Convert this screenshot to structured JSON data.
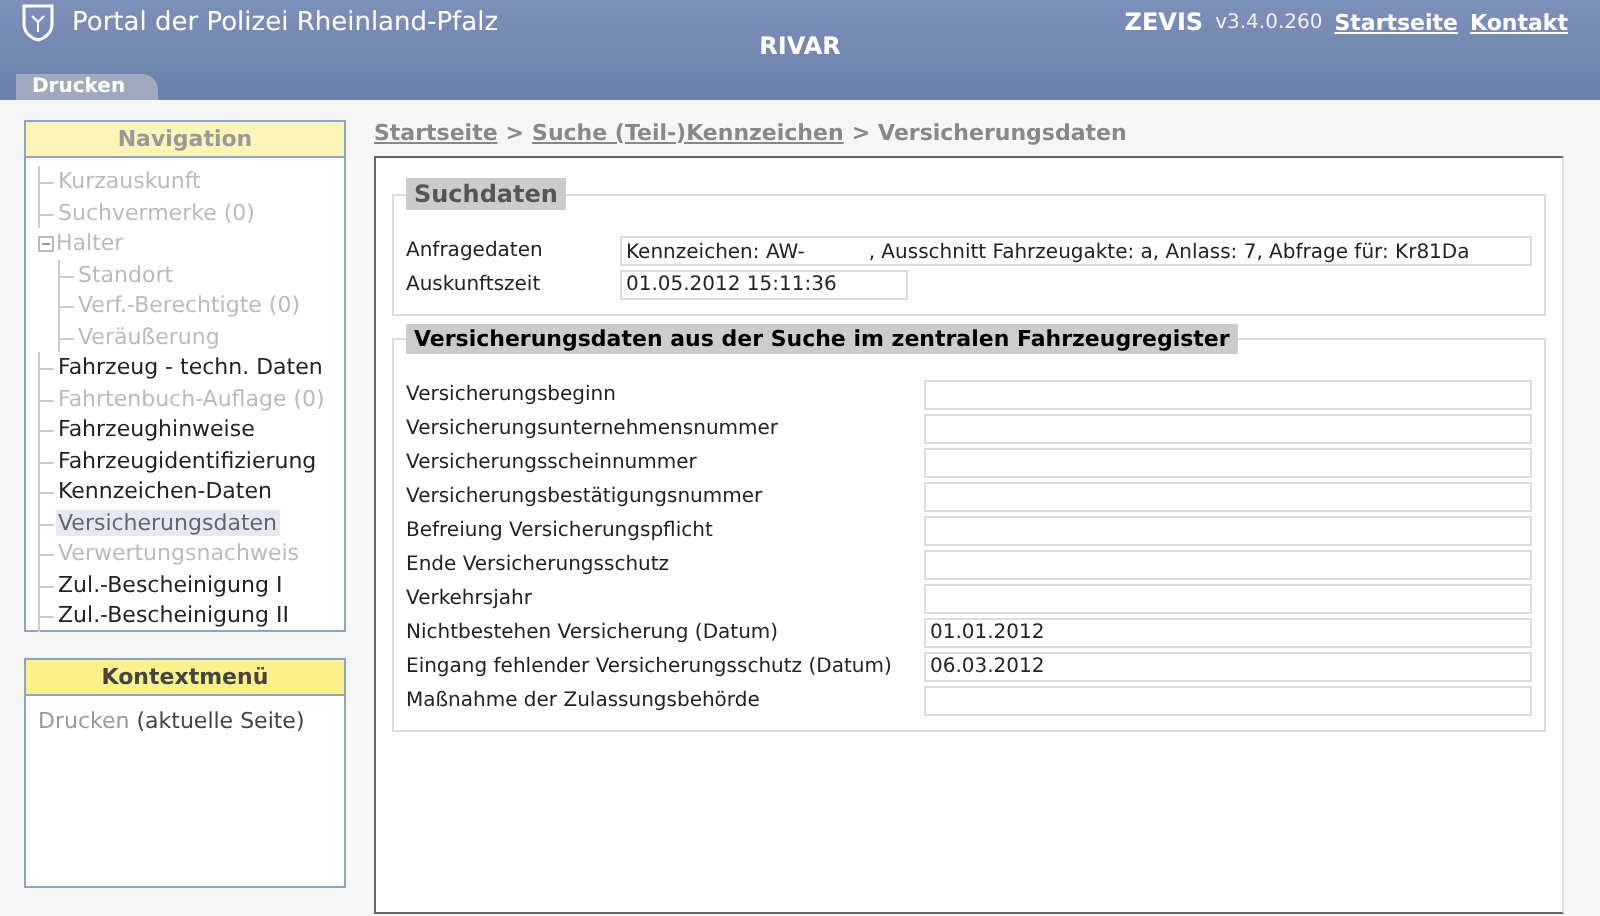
{
  "header": {
    "portal_title": "Portal der Polizei Rheinland-Pfalz",
    "app_title": "RIVAR",
    "product": "ZEVIS",
    "version": "v3.4.0.260",
    "links": [
      "Startseite",
      "Kontakt"
    ]
  },
  "tabs": [
    {
      "label": "Drucken",
      "selected": true
    }
  ],
  "navigation": {
    "title": "Navigation",
    "items": [
      {
        "label": "Kurzauskunft",
        "disabled": true,
        "selected": false
      },
      {
        "label": "Suchvermerke (0)",
        "disabled": true,
        "selected": false
      },
      {
        "label": "Halter",
        "disabled": true,
        "selected": false,
        "expanded": true,
        "children": [
          {
            "label": "Standort",
            "disabled": true,
            "selected": false
          },
          {
            "label": "Verf.-Berechtigte (0)",
            "disabled": true,
            "selected": false
          },
          {
            "label": "Veräußerung",
            "disabled": true,
            "selected": false
          }
        ]
      },
      {
        "label": "Fahrzeug - techn. Daten",
        "disabled": false,
        "selected": false
      },
      {
        "label": "Fahrtenbuch-Auflage (0)",
        "disabled": true,
        "selected": false
      },
      {
        "label": "Fahrzeughinweise",
        "disabled": false,
        "selected": false
      },
      {
        "label": "Fahrzeugidentifizierung",
        "disabled": false,
        "selected": false
      },
      {
        "label": "Kennzeichen-Daten",
        "disabled": false,
        "selected": false
      },
      {
        "label": "Versicherungsdaten",
        "disabled": false,
        "selected": true
      },
      {
        "label": "Verwertungsnachweis",
        "disabled": true,
        "selected": false
      },
      {
        "label": "Zul.-Bescheinigung I",
        "disabled": false,
        "selected": false
      },
      {
        "label": "Zul.-Bescheinigung II",
        "disabled": false,
        "selected": false
      }
    ]
  },
  "context_menu": {
    "title": "Kontextmenü",
    "items": [
      {
        "link": "Drucken",
        "note": "(aktuelle Seite)"
      }
    ]
  },
  "breadcrumb": [
    {
      "label": "Startseite",
      "link": true
    },
    {
      "label": "Suche (Teil-)Kennzeichen",
      "link": true
    },
    {
      "label": "Versicherungsdaten",
      "link": false
    }
  ],
  "separator": ">",
  "sections": [
    {
      "legend": "Suchdaten",
      "wide": true,
      "fields": [
        {
          "label": "Anfragedaten",
          "value_parts": [
            "Kennzeichen: AW-",
            ", Ausschnitt Fahrzeugakte: a, Anlass: 7, Abfrage für: Kr81Da"
          ],
          "redacted": true
        },
        {
          "label": "Auskunftszeit",
          "value": "01.05.2012 15:11:36"
        }
      ]
    },
    {
      "legend": "Versicherungsdaten aus der Suche im zentralen Fahrzeugregister",
      "wide": false,
      "fields": [
        {
          "label": "Versicherungsbeginn"
        },
        {
          "label": "Versicherungsunternehmensnummer"
        },
        {
          "label": "Versicherungsscheinnummer"
        },
        {
          "label": "Versicherungsbestätigungsnummer"
        },
        {
          "label": "Befreiung Versicherungspflicht"
        },
        {
          "label": "Ende Versicherungsschutz"
        },
        {
          "label": "Verkehrsjahr"
        },
        {
          "label": "Nichtbestehen Versicherung (Datum)",
          "value": "01.01.2012"
        },
        {
          "label": "Eingang fehlender Versicherungsschutz (Datum)",
          "value": "06.03.2012"
        },
        {
          "label": "Maßnahme der Zulassungsbehörde"
        }
      ]
    }
  ]
}
